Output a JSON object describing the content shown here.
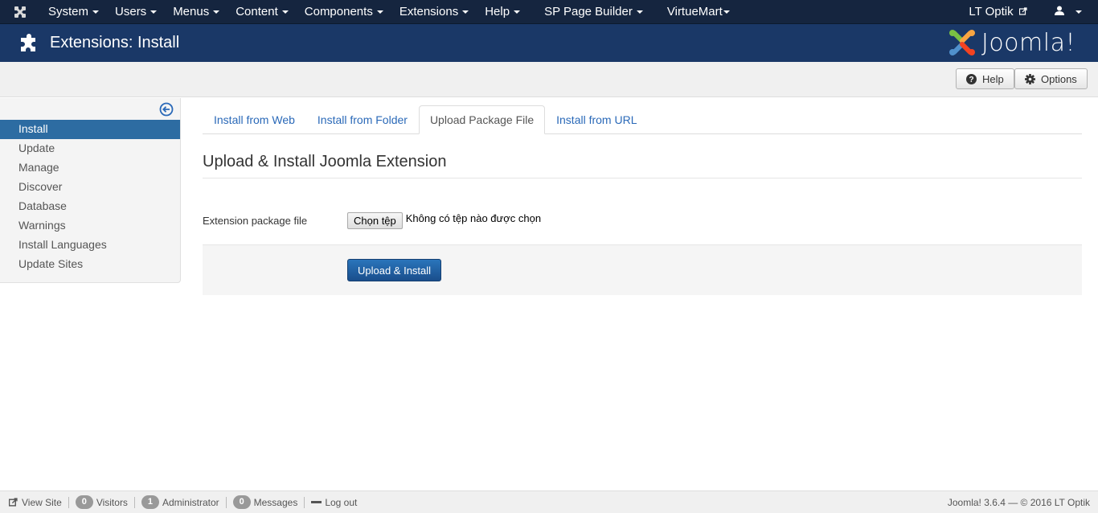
{
  "topnav": {
    "menu": [
      {
        "label": "System"
      },
      {
        "label": "Users"
      },
      {
        "label": "Menus"
      },
      {
        "label": "Content"
      },
      {
        "label": "Components"
      },
      {
        "label": "Extensions"
      },
      {
        "label": "Help"
      },
      {
        "label": "SP Page Builder"
      },
      {
        "label": "VirtueMart"
      }
    ],
    "site_link": "LT Optik",
    "user_icon": "user-icon"
  },
  "header": {
    "title": "Extensions: Install",
    "icon": "puzzle-icon",
    "brand": "Joomla!"
  },
  "toolbar": {
    "help_label": "Help",
    "options_label": "Options"
  },
  "sidebar": {
    "items": [
      {
        "label": "Install",
        "active": true
      },
      {
        "label": "Update"
      },
      {
        "label": "Manage"
      },
      {
        "label": "Discover"
      },
      {
        "label": "Database"
      },
      {
        "label": "Warnings"
      },
      {
        "label": "Install Languages"
      },
      {
        "label": "Update Sites"
      }
    ]
  },
  "tabs": [
    {
      "label": "Install from Web"
    },
    {
      "label": "Install from Folder"
    },
    {
      "label": "Upload Package File",
      "active": true
    },
    {
      "label": "Install from URL"
    }
  ],
  "form": {
    "legend": "Upload & Install Joomla Extension",
    "field_label": "Extension package file",
    "file_button": "Chọn tệp",
    "file_status": "Không có tệp nào được chọn",
    "submit_label": "Upload & Install"
  },
  "status": {
    "view_site": "View Site",
    "visitors_count": "0",
    "visitors_label": "Visitors",
    "admin_count": "1",
    "admin_label": "Administrator",
    "messages_count": "0",
    "messages_label": "Messages",
    "logout_label": "Log out",
    "version": "Joomla! 3.6.4  —  © 2016 LT Optik"
  }
}
